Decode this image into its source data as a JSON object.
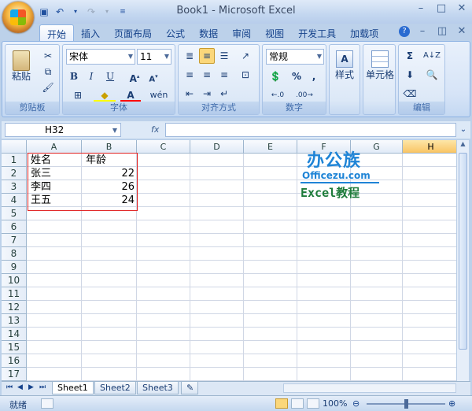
{
  "title": "Book1 - Microsoft Excel",
  "ribbon_tabs": [
    "开始",
    "插入",
    "页面布局",
    "公式",
    "数据",
    "审阅",
    "视图",
    "开发工具",
    "加载项"
  ],
  "groups": {
    "clipboard": {
      "label": "剪贴板",
      "paste": "粘贴"
    },
    "font": {
      "label": "字体",
      "font_name": "宋体",
      "font_size": "11"
    },
    "alignment": {
      "label": "对齐方式"
    },
    "number": {
      "label": "数字",
      "format": "常规",
      "percent": "%",
      "comma": ","
    },
    "styles": {
      "label": "样式"
    },
    "cells": {
      "label": "单元格"
    },
    "editing": {
      "label": "编辑"
    }
  },
  "name_box": "H32",
  "fx": "fx",
  "columns": [
    "A",
    "B",
    "C",
    "D",
    "E",
    "F",
    "G",
    "H"
  ],
  "selected_column": "H",
  "rows": [
    "1",
    "2",
    "3",
    "4",
    "5",
    "6",
    "7",
    "8",
    "9",
    "10",
    "11",
    "12",
    "13",
    "14",
    "15",
    "16",
    "17"
  ],
  "cells": {
    "A1": "姓名",
    "B1": "年龄",
    "A2": "张三",
    "B2": "22",
    "A3": "李四",
    "B3": "26",
    "A4": "王五",
    "B4": "24"
  },
  "watermark": {
    "logo": "办公族",
    "site": "Officezu.com",
    "tagline": "Excel教程"
  },
  "sheets": [
    "Sheet1",
    "Sheet2",
    "Sheet3"
  ],
  "active_sheet": "Sheet1",
  "status": {
    "ready": "就绪",
    "zoom": "100%"
  }
}
